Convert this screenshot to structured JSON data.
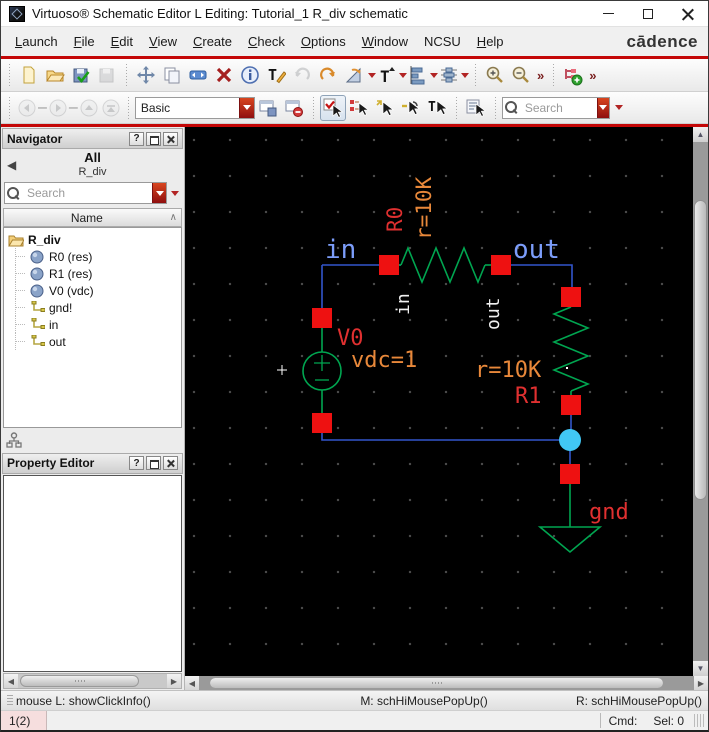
{
  "window": {
    "title": "Virtuoso® Schematic Editor L Editing: Tutorial_1 R_div schematic"
  },
  "menu": {
    "items": [
      "Launch",
      "File",
      "Edit",
      "View",
      "Create",
      "Check",
      "Options",
      "Window",
      "NCSU",
      "Help"
    ],
    "brand": "cādence"
  },
  "toolbar1": {
    "icons": [
      "new-file",
      "open-file",
      "check-and-save",
      "save",
      "move",
      "copy",
      "stretch",
      "delete",
      "properties",
      "text-edit",
      "undo",
      "redo",
      "rotate",
      "text-style",
      "align",
      "distribute",
      "zoom-in",
      "zoom-out",
      "create-instance"
    ],
    "overflow_glyph": "»"
  },
  "toolbar2": {
    "icons": [
      "go-back",
      "go-forward",
      "go-up",
      "go-top",
      "save-workspace",
      "delete-workspace",
      "select-filter",
      "partial-select",
      "full-select",
      "deselect",
      "text-select",
      "selection-set",
      "search-options"
    ],
    "workspace_value": "Basic",
    "search_placeholder": "Search"
  },
  "navigator": {
    "title": "Navigator",
    "help_glyph": "?",
    "scope": "All",
    "cell": "R_div",
    "search_placeholder": "Search",
    "column_header": "Name",
    "tree": {
      "root": "R_div",
      "children": [
        {
          "label": "R0 (res)",
          "type": "instance"
        },
        {
          "label": "R1 (res)",
          "type": "instance"
        },
        {
          "label": "V0 (vdc)",
          "type": "instance"
        },
        {
          "label": "gnd!",
          "type": "net"
        },
        {
          "label": "in",
          "type": "net"
        },
        {
          "label": "out",
          "type": "net"
        }
      ]
    }
  },
  "property_editor": {
    "title": "Property Editor",
    "help_glyph": "?"
  },
  "schematic": {
    "net_in": "in",
    "net_out": "out",
    "r0_name": "R0",
    "r0_value": "r=10K",
    "r0_pin_left": "in",
    "r0_pin_right": "out",
    "v0_name": "V0",
    "v0_value": "vdc=1",
    "r1_value": "r=10K",
    "r1_name": "R1",
    "gnd_label": "gnd"
  },
  "status_bar": {
    "left": "mouse L: showClickInfo()",
    "middle": "M: schHiMousePopUp()",
    "right": "R: schHiMousePopUp()"
  },
  "bottom_bar": {
    "left": "1(2)",
    "cmd_label": "Cmd:",
    "sel_label": "Sel: 0"
  },
  "colors": {
    "accent_red": "#c40707",
    "wire_blue": "#3355cc",
    "label_blue": "#7c9dfa",
    "component_green": "#00a550",
    "pin_red": "#ee1111",
    "label_red": "#e03030",
    "label_orange": "#e8883a",
    "solder_cyan": "#41c7f4",
    "canvas_bg": "#000000"
  }
}
